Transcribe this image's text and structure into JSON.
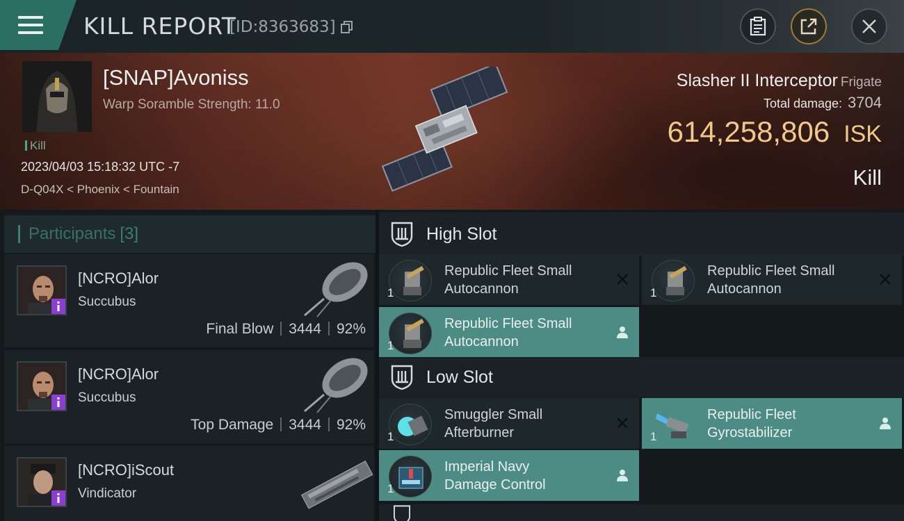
{
  "header": {
    "title": "KILL REPORT",
    "id_text": "[ID:8363683]"
  },
  "victim": {
    "name": "[SNAP]Avoniss",
    "subtitle": "Warp Soramble Strength: 11.0",
    "tag": "Kill",
    "datetime": "2023/04/03 15:18:32 UTC -7",
    "location": "D-Q04X < Phoenix < Fountain"
  },
  "ship": {
    "name": "Slasher II Interceptor",
    "class": "Frigate",
    "damage_label": "Total damage:",
    "damage_value": "3704",
    "isk_value": "614,258,806",
    "isk_unit": "ISK",
    "result": "Kill"
  },
  "participants": {
    "title": "Participants",
    "count": "[3]",
    "rows": [
      {
        "name": "[NCRO]Alor",
        "ship": "Succubus",
        "role": "Final Blow",
        "damage": "3444",
        "percent": "92%"
      },
      {
        "name": "[NCRO]Alor",
        "ship": "Succubus",
        "role": "Top Damage",
        "damage": "3444",
        "percent": "92%"
      },
      {
        "name": "[NCRO]iScout",
        "ship": "Vindicator",
        "role": "",
        "damage": "",
        "percent": ""
      }
    ]
  },
  "slots": {
    "high": {
      "title": "High Slot",
      "modules": [
        {
          "line1": "Republic Fleet Small",
          "line2": "Autocannon",
          "qty": "1",
          "state": "destroyed"
        },
        {
          "line1": "Republic Fleet Small",
          "line2": "Autocannon",
          "qty": "1",
          "state": "destroyed"
        },
        {
          "line1": "Republic Fleet Small",
          "line2": "Autocannon",
          "qty": "1",
          "state": "dropped"
        }
      ]
    },
    "low": {
      "title": "Low Slot",
      "modules": [
        {
          "line1": "Smuggler Small",
          "line2": "Afterburner",
          "qty": "1",
          "state": "destroyed"
        },
        {
          "line1": "Republic Fleet",
          "line2": "Gyrostabilizer",
          "qty": "1",
          "state": "dropped"
        },
        {
          "line1": "Imperial Navy",
          "line2": "Damage Control",
          "qty": "1",
          "state": "dropped"
        }
      ]
    }
  },
  "colors": {
    "accent_teal": "#4d8c84",
    "isk_gold": "#f1c98a",
    "badge_purple": "#8a3fd1"
  }
}
